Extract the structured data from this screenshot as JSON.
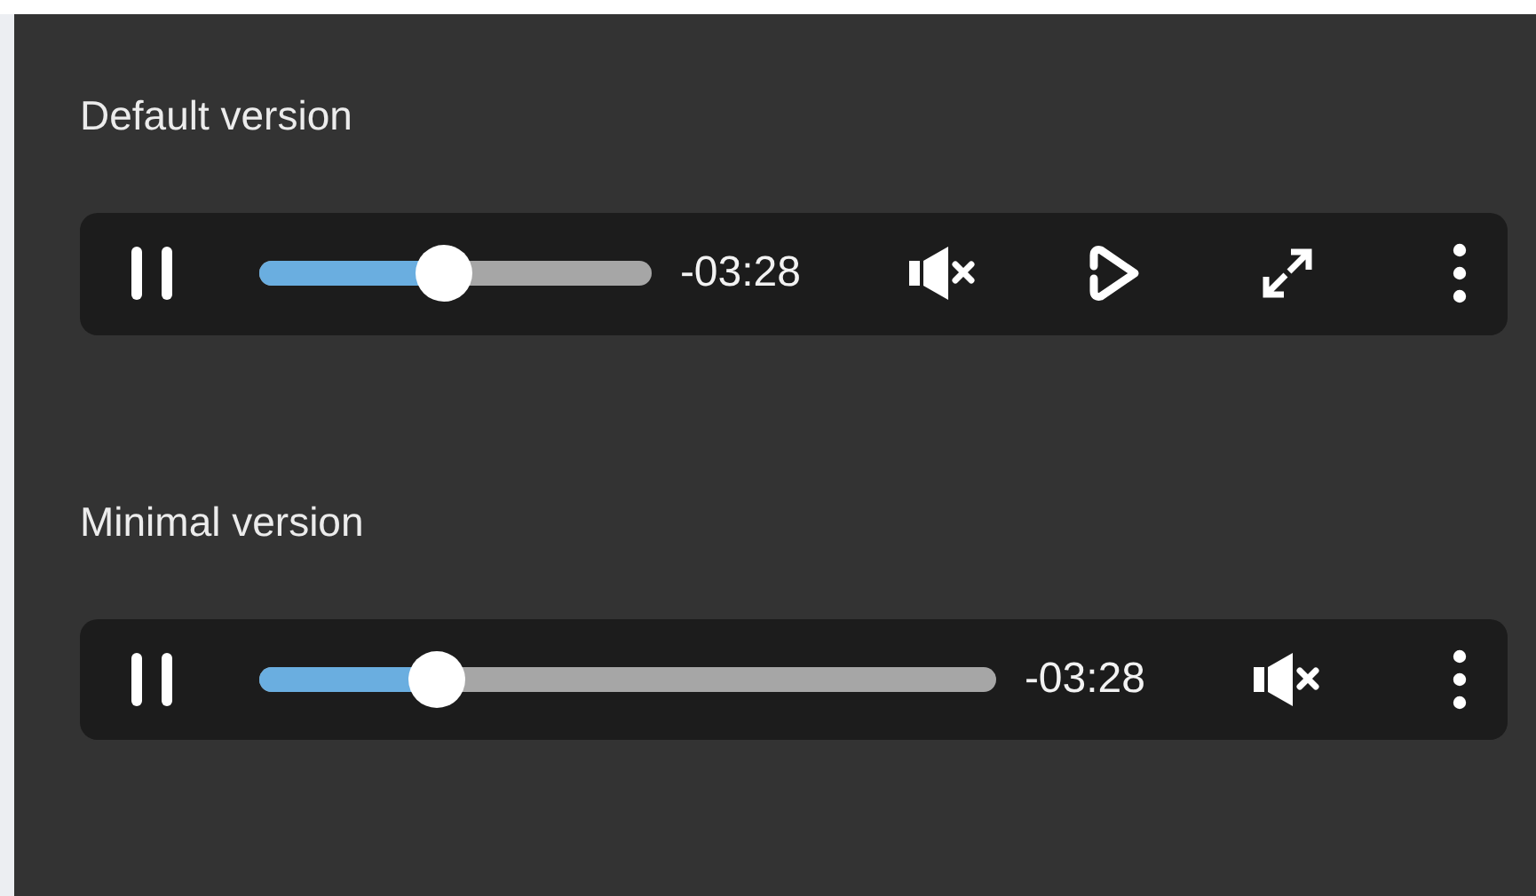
{
  "players": [
    {
      "title": "Default version",
      "playing": true,
      "progress": {
        "level": 0.47
      },
      "time": "-03:28",
      "controls": [
        {
          "kind": "mute"
        },
        {
          "kind": "replay"
        },
        {
          "kind": "fullscreen"
        },
        {
          "kind": "menu"
        }
      ]
    },
    {
      "title": "Minimal version",
      "playing": true,
      "progress": {
        "level": 0.24
      },
      "time": "-03:28",
      "controls": [
        {
          "kind": "mute"
        },
        {
          "kind": "menu"
        }
      ]
    }
  ]
}
